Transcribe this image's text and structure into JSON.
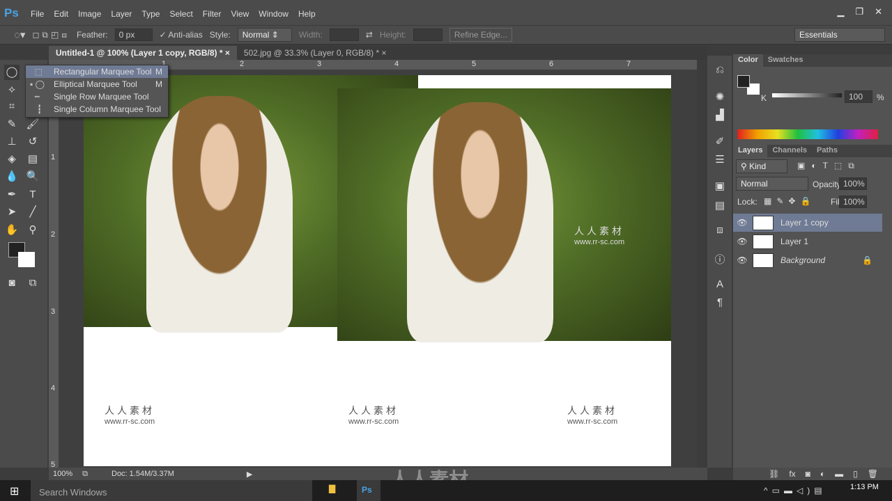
{
  "app": {
    "logo": "Ps",
    "menu": [
      "File",
      "Edit",
      "Image",
      "Layer",
      "Type",
      "Select",
      "Filter",
      "View",
      "Window",
      "Help"
    ],
    "window_buttons": [
      "minimize",
      "restore",
      "close"
    ]
  },
  "options": {
    "feather_label": "Feather:",
    "feather_value": "0 px",
    "antialias_label": "Anti-alias",
    "antialias_checked": true,
    "style_label": "Style:",
    "style_value": "Normal",
    "width_label": "Width:",
    "height_label": "Height:",
    "refine_edge": "Refine Edge...",
    "workspace": "Essentials"
  },
  "tabs": [
    {
      "label": "Untitled-1 @ 100% (Layer 1 copy, RGB/8) *",
      "active": true
    },
    {
      "label": "502.jpg @ 33.3% (Layer 0, RGB/8) *",
      "active": false
    }
  ],
  "ruler": {
    "top": [
      "1",
      "2",
      "3",
      "4",
      "5",
      "6",
      "7"
    ],
    "left": [
      "1",
      "2",
      "3",
      "4",
      "5"
    ]
  },
  "flyout": [
    {
      "label": "Rectangular Marquee Tool",
      "key": "M",
      "highlighted": true,
      "current": false
    },
    {
      "label": "Elliptical Marquee Tool",
      "key": "M",
      "highlighted": false,
      "current": true
    },
    {
      "label": "Single Row Marquee Tool",
      "key": "",
      "highlighted": false,
      "current": false
    },
    {
      "label": "Single Column Marquee Tool",
      "key": "",
      "highlighted": false,
      "current": false
    }
  ],
  "watermark": {
    "cn": "人人素材",
    "url": "www.rr-sc.com",
    "center": "人人素材"
  },
  "color_panel": {
    "tabs": [
      "Color",
      "Swatches"
    ],
    "channel": "K",
    "value": "100",
    "unit": "%"
  },
  "layers_panel": {
    "tabs": [
      "Layers",
      "Channels",
      "Paths"
    ],
    "filter": "Kind",
    "blend_mode": "Normal",
    "opacity_label": "Opacity:",
    "opacity": "100%",
    "lock_label": "Lock:",
    "fill_label": "Fill:",
    "fill": "100%",
    "layers": [
      {
        "name": "Layer 1 copy",
        "selected": true,
        "visible": true
      },
      {
        "name": "Layer 1",
        "selected": false,
        "visible": true
      },
      {
        "name": "Background",
        "selected": false,
        "visible": true,
        "locked": true
      }
    ]
  },
  "status": {
    "zoom": "100%",
    "doc": "Doc: 1.54M/3.37M"
  },
  "taskbar": {
    "search": "Search Windows",
    "time": "1:13 PM"
  },
  "colors": {
    "selection": "#6f7a94",
    "ps_blue": "#4aa3e6"
  }
}
